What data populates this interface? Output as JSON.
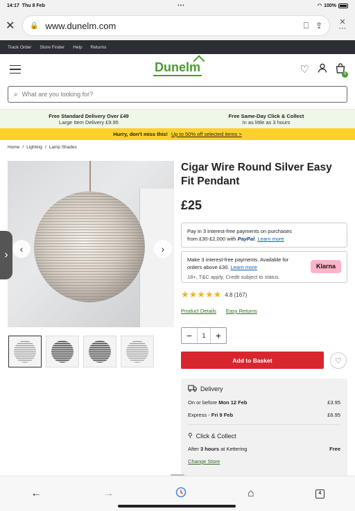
{
  "status_bar": {
    "time": "14:17",
    "date": "Thu 8 Feb",
    "dots": "•••",
    "battery": "100%"
  },
  "browser": {
    "url": "www.dunelm.com",
    "close_glyph": "✕",
    "lock_glyph": "🔒",
    "bookmark_glyph": "⎕",
    "share_glyph": "⇪",
    "more_glyph": "⋯"
  },
  "top_nav": {
    "items": [
      "Track Order",
      "Store Finder",
      "Help",
      "Returns"
    ]
  },
  "header": {
    "logo": "Dunelm",
    "basket_count": "0"
  },
  "search": {
    "placeholder": "What are you looking for?"
  },
  "delivery_strip": {
    "left_title": "Free Standard Delivery Over £49",
    "left_sub": "Large Item Delivery £9.95",
    "right_title": "Free Same-Day Click & Collect",
    "right_sub": "In as little as 3 hours"
  },
  "promo": {
    "text": "Hurry, don't miss this!",
    "link": "Up to 50% off selected items >"
  },
  "breadcrumb": {
    "items": [
      "Home",
      "/",
      "Lighting",
      "/",
      "Lamp Shades"
    ]
  },
  "product": {
    "title": "Cigar Wire Round Silver Easy Fit Pendant",
    "price": "£25",
    "paypal_line1": "Pay in 3 interest-free payments on purchases",
    "paypal_line2": "from £30-£2,000 with",
    "paypal_brand": "PayPal",
    "paypal_link": "Learn more",
    "klarna_line1": "Make 3 interest-free payments. Available for",
    "klarna_line2": "orders above £30.",
    "klarna_link": "Learn more",
    "klarna_small": "18+, T&C apply, Credit subject to status.",
    "klarna_badge": "Klarna",
    "stars": "★★★★★",
    "rating": "4.8 (167)",
    "link_details": "Product Details",
    "link_returns": "Easy Returns",
    "qty_minus": "−",
    "qty_value": "1",
    "qty_plus": "+",
    "add_to_basket": "Add to Basket",
    "wishlist_glyph": "♡"
  },
  "delivery": {
    "heading": "Delivery",
    "row1_label_pre": "On or before ",
    "row1_label_bold": "Mon 12 Feb",
    "row1_price": "£3.95",
    "row2_label_pre": "Express - ",
    "row2_label_bold": "Fri 9 Feb",
    "row2_price": "£6.95",
    "cc_heading": "Click & Collect",
    "cc_pre": "After ",
    "cc_bold": "3 hours",
    "cc_post": " at Kettering",
    "cc_price": "Free",
    "change_store": "Change Store"
  },
  "bottom_bar": {
    "tab_count": "4"
  }
}
